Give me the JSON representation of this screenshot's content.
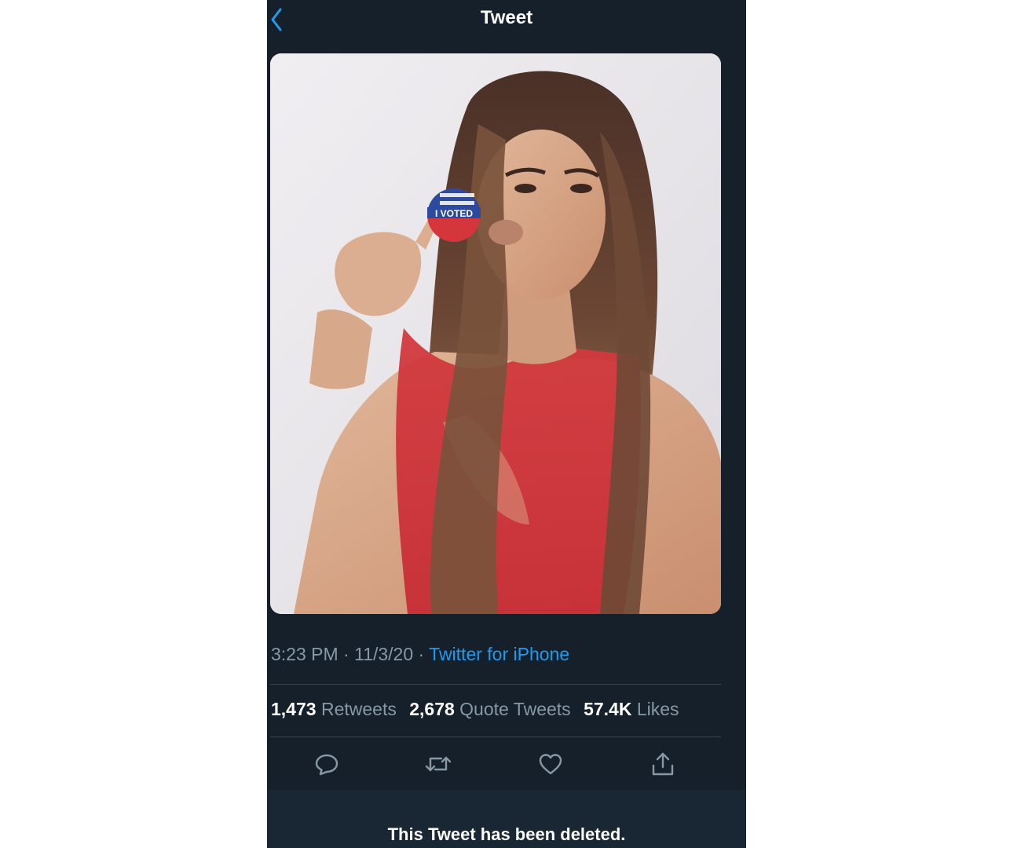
{
  "header": {
    "title": "Tweet",
    "back_icon": "chevron-left-icon"
  },
  "tweet": {
    "sticker_text": "I VOTED",
    "time": "3:23 PM",
    "date": "11/3/20",
    "source": "Twitter for iPhone",
    "stats": [
      {
        "count": "1,473",
        "label": "Retweets"
      },
      {
        "count": "2,678",
        "label": "Quote Tweets"
      },
      {
        "count": "57.4K",
        "label": "Likes"
      }
    ],
    "actions": [
      "reply-icon",
      "retweet-icon",
      "like-icon",
      "share-icon"
    ]
  },
  "notice": {
    "text": "This Tweet has been deleted."
  },
  "colors": {
    "background": "#15202b",
    "accent": "#1d9bf0",
    "muted": "#8899a6"
  }
}
